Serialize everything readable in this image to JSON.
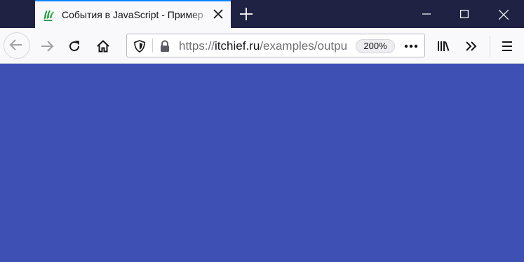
{
  "tab": {
    "title": "События в JavaScript - Пример",
    "favicon": "itchief-hand-icon",
    "favicon_color": "#25a243"
  },
  "window_controls": {
    "minimize": "minimize-icon",
    "maximize": "maximize-icon",
    "close": "close-icon"
  },
  "navbar": {
    "url_scheme": "https://",
    "url_host": "itchief.ru",
    "url_path": "/examples/output",
    "zoom_level": "200%"
  },
  "page": {
    "background_color": "#3e50b4"
  },
  "colors": {
    "tabbar": "#1f2243",
    "tab_accent": "#0a84ff",
    "toolbar": "#f9f9fb"
  }
}
